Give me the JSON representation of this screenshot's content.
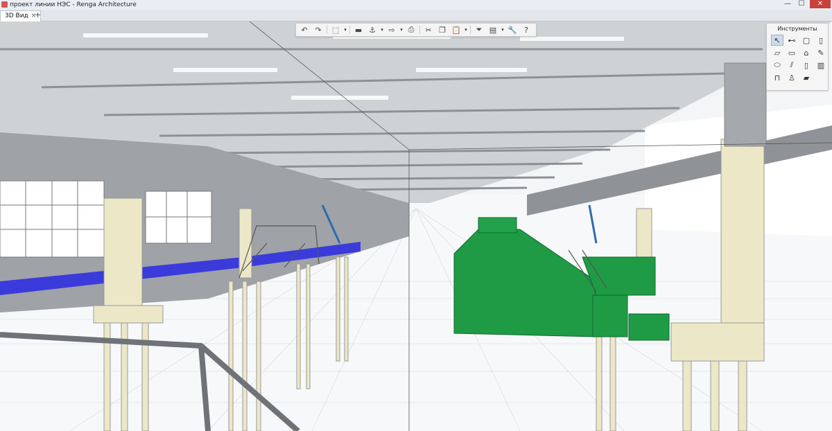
{
  "window": {
    "title": "проект линии НЭС - Renga Architecture",
    "minimize_glyph": "—",
    "maximize_glyph": "☐",
    "close_glyph": "✕"
  },
  "tabs": [
    {
      "label": "3D Вид",
      "close_glyph": "×"
    }
  ],
  "add_tab_glyph": "+",
  "toolbar": {
    "buttons": [
      {
        "icon": "undo-icon",
        "glyph": "↶"
      },
      {
        "icon": "redo-icon",
        "glyph": "↷"
      },
      {
        "icon": "cube-view-icon",
        "glyph": "⬚"
      },
      {
        "icon": "dropdown-icon",
        "glyph": "▾"
      },
      {
        "icon": "folder-icon",
        "glyph": "▬"
      },
      {
        "icon": "stamp-icon",
        "glyph": "⚓"
      },
      {
        "icon": "dropdown-icon",
        "glyph": "▾"
      },
      {
        "icon": "export-icon",
        "glyph": "⇨"
      },
      {
        "icon": "dropdown-icon",
        "glyph": "▾"
      },
      {
        "icon": "print-icon",
        "glyph": "⎙"
      },
      {
        "icon": "cut-icon",
        "glyph": "✂"
      },
      {
        "icon": "copy-icon",
        "glyph": "❐"
      },
      {
        "icon": "paste-icon",
        "glyph": "📋"
      },
      {
        "icon": "dropdown-icon",
        "glyph": "▾"
      },
      {
        "icon": "filter-icon",
        "glyph": "⏷"
      },
      {
        "icon": "layers-icon",
        "glyph": "▤"
      },
      {
        "icon": "dropdown-icon",
        "glyph": "▾"
      },
      {
        "icon": "wrench-icon",
        "glyph": "🔧"
      },
      {
        "icon": "help-icon",
        "glyph": "?"
      }
    ]
  },
  "tools_panel": {
    "title": "Инструменты",
    "tools": [
      {
        "icon": "select-arrow-icon",
        "glyph": "↖",
        "active": true
      },
      {
        "icon": "snap-icon",
        "glyph": "⊷"
      },
      {
        "icon": "wall-icon",
        "glyph": "▢"
      },
      {
        "icon": "column-icon",
        "glyph": "▯"
      },
      {
        "icon": "slab-icon",
        "glyph": "▱"
      },
      {
        "icon": "floor-icon",
        "glyph": "▭"
      },
      {
        "icon": "roof-icon",
        "glyph": "⌂"
      },
      {
        "icon": "pencil-icon",
        "glyph": "✎"
      },
      {
        "icon": "beam-icon",
        "glyph": "⬭"
      },
      {
        "icon": "stair-icon",
        "glyph": "⫽"
      },
      {
        "icon": "door-icon",
        "glyph": "▯"
      },
      {
        "icon": "window-icon",
        "glyph": "▥"
      },
      {
        "icon": "equipment-icon",
        "glyph": "⊓"
      },
      {
        "icon": "figure-icon",
        "glyph": "♙"
      },
      {
        "icon": "opening-icon",
        "glyph": "▰"
      }
    ]
  },
  "colors": {
    "equipment_green": "#1f9a45",
    "accent_blue": "#3b3bdc",
    "column_cream": "#ece7c6",
    "structure_gray": "#9a9ea3",
    "roof_light": "#d8dadc"
  }
}
